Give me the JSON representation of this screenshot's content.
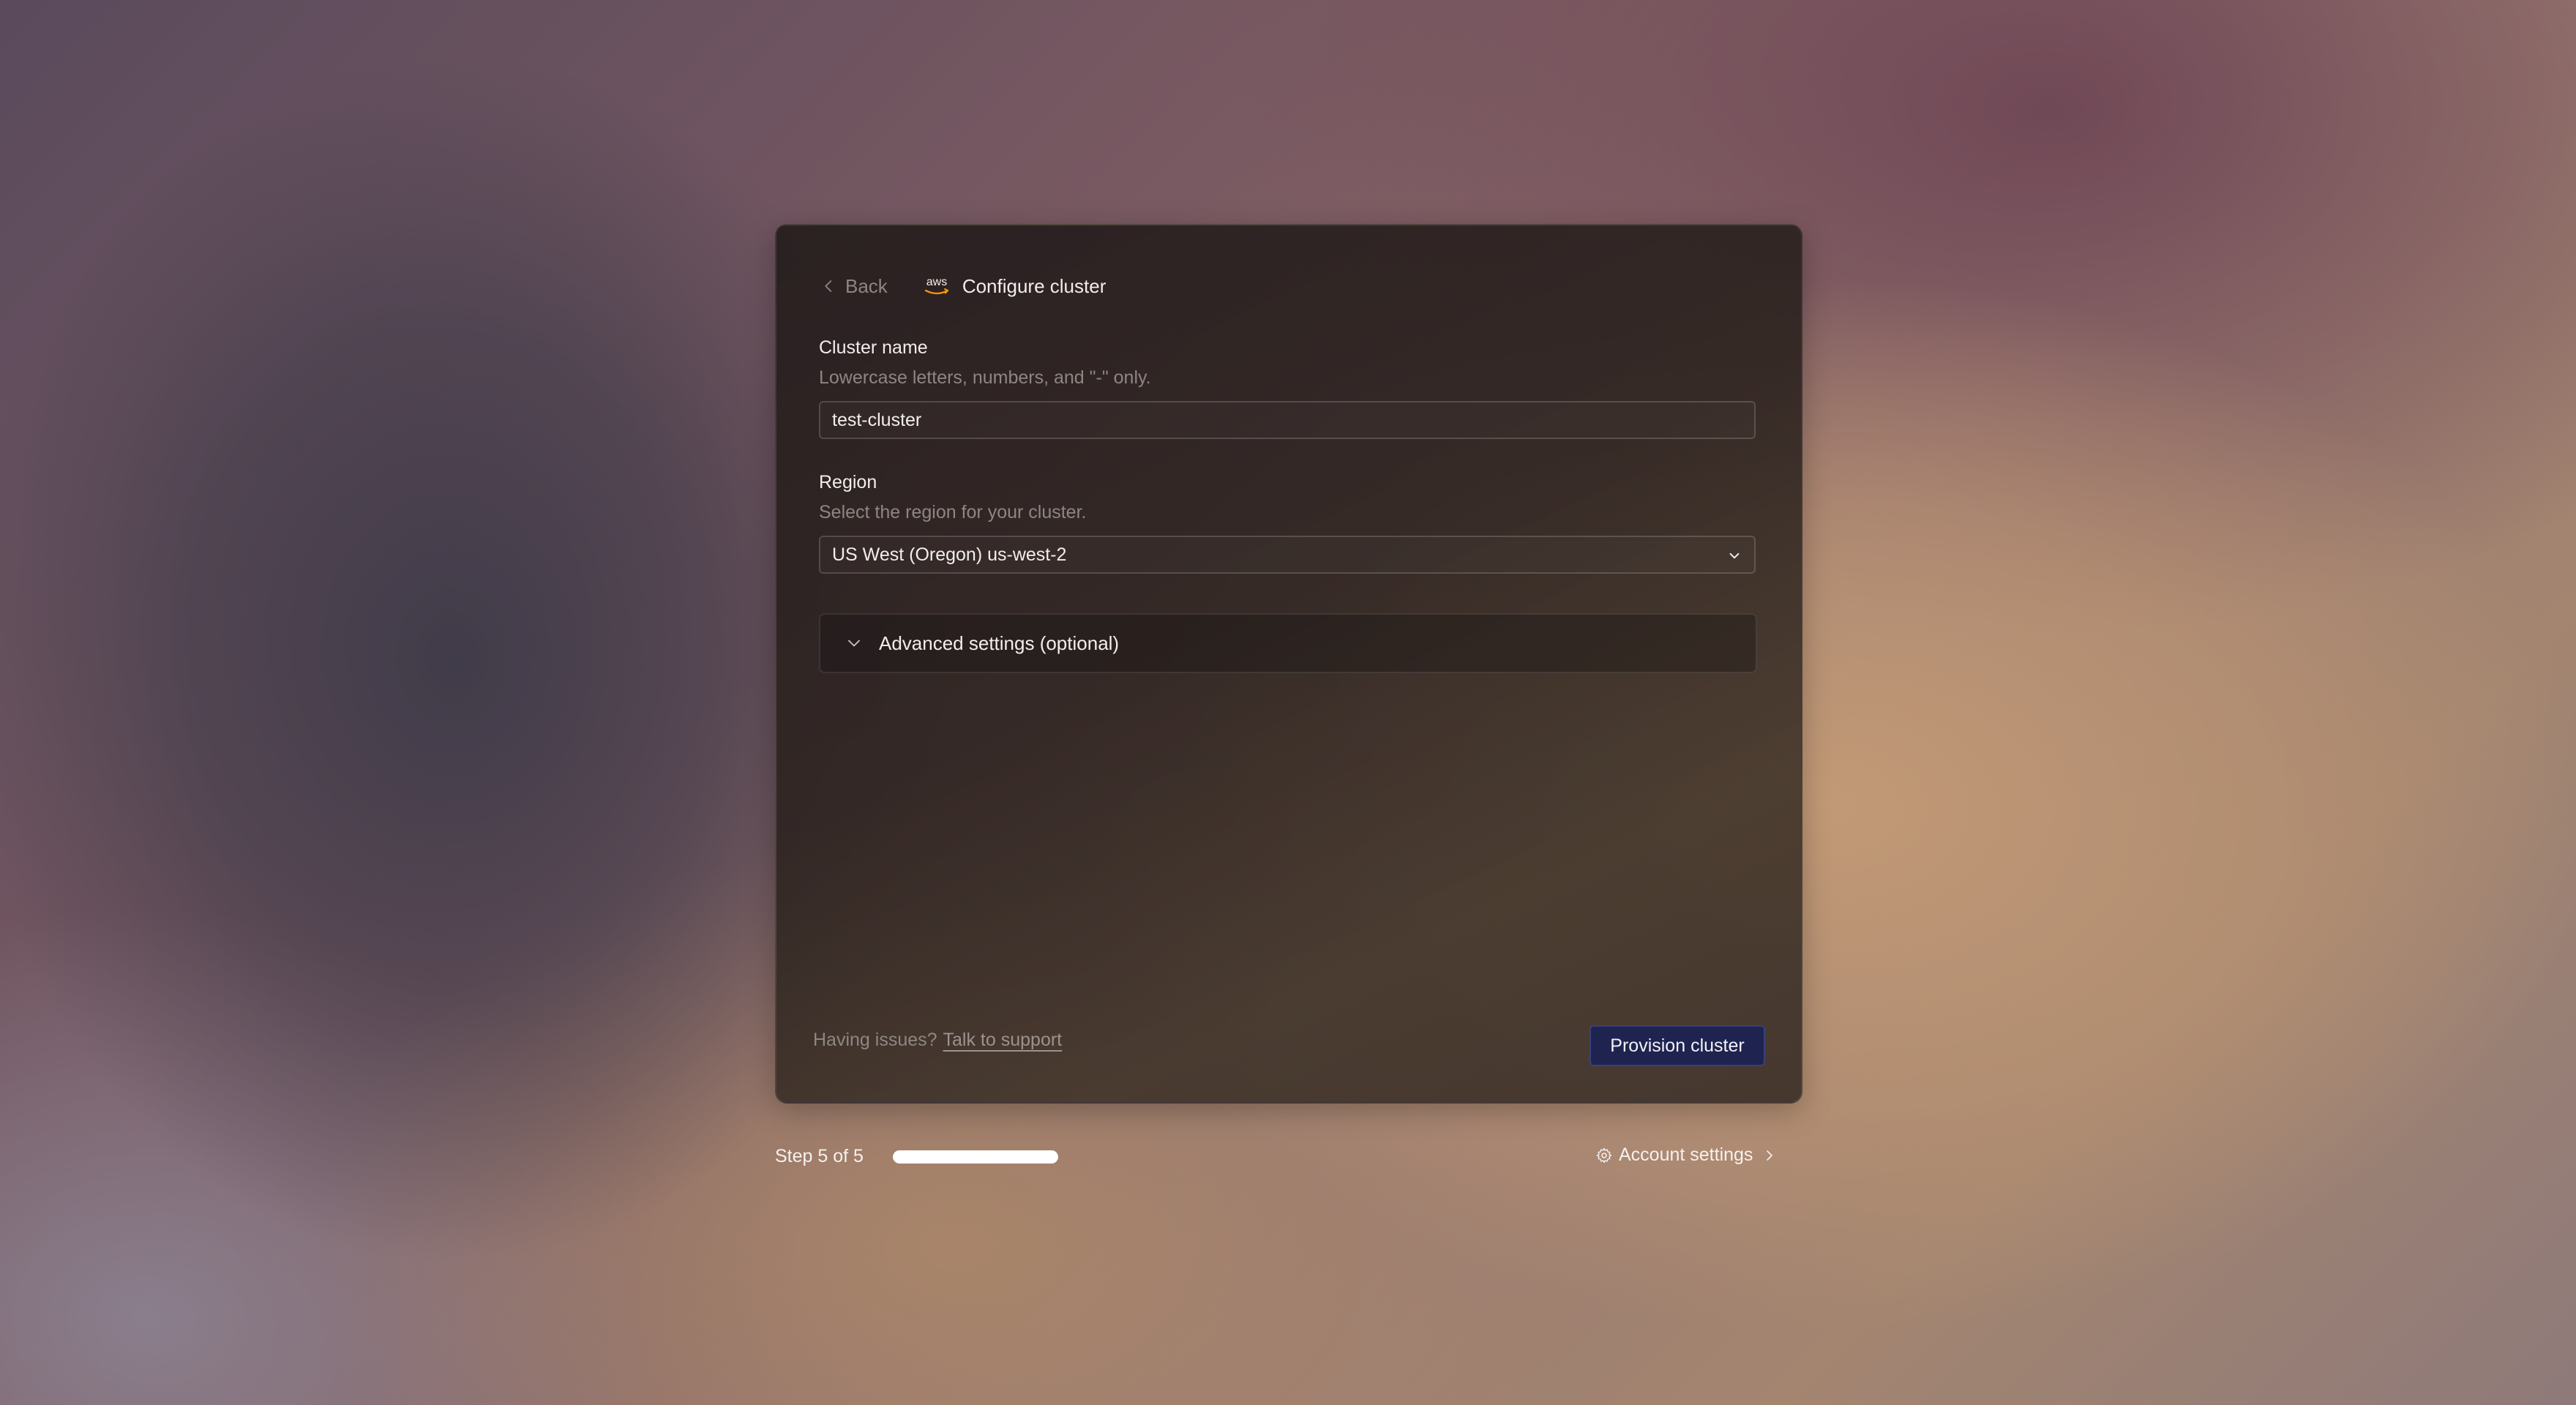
{
  "header": {
    "back_label": "Back",
    "provider_logo": "aws-logo",
    "title": "Configure cluster"
  },
  "form": {
    "cluster_name": {
      "label": "Cluster name",
      "help": "Lowercase letters, numbers, and \"-\" only.",
      "value": "test-cluster"
    },
    "region": {
      "label": "Region",
      "help": "Select the region for your cluster.",
      "selected": "US West (Oregon) us-west-2"
    },
    "advanced": {
      "label": "Advanced settings (optional)",
      "expanded": false
    }
  },
  "footer": {
    "issues_text": "Having issues?",
    "support_link": "Talk to support",
    "primary_button": "Provision cluster"
  },
  "progress": {
    "step_text": "Step 5 of 5",
    "fraction": 1.0
  },
  "account": {
    "label": "Account settings",
    "icon": "gear-icon"
  },
  "colors": {
    "primary_button_bg": "#1f2350",
    "aws_accent": "#ff9900"
  }
}
